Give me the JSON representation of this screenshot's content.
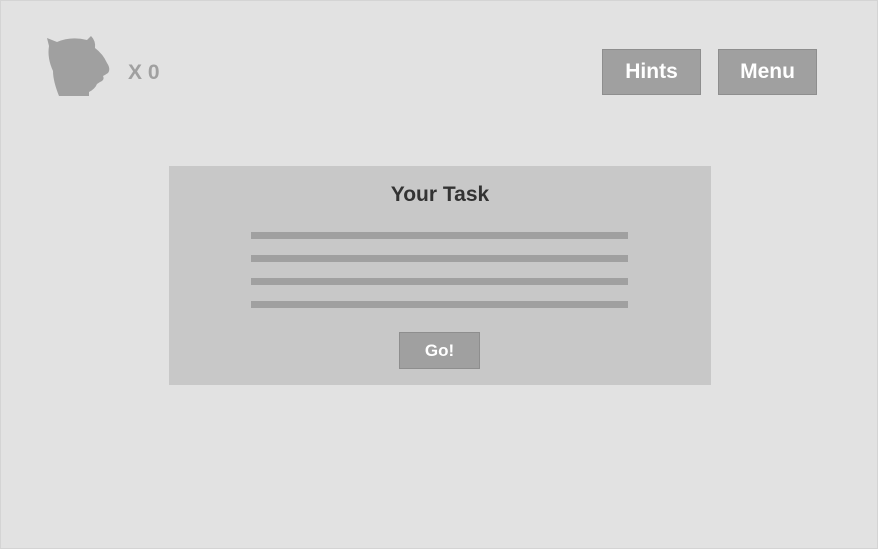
{
  "header": {
    "avatar_icon": "cat-head-silhouette-icon",
    "counter_text": "X 0",
    "hints_label": "Hints",
    "menu_label": "Menu"
  },
  "task": {
    "title": "Your Task",
    "placeholder_line_count": 4,
    "go_label": "Go!"
  },
  "colors": {
    "background": "#e2e2e2",
    "panel": "#c8c8c8",
    "button": "#a0a0a0",
    "button_text": "#ffffff",
    "title_text": "#333333"
  }
}
